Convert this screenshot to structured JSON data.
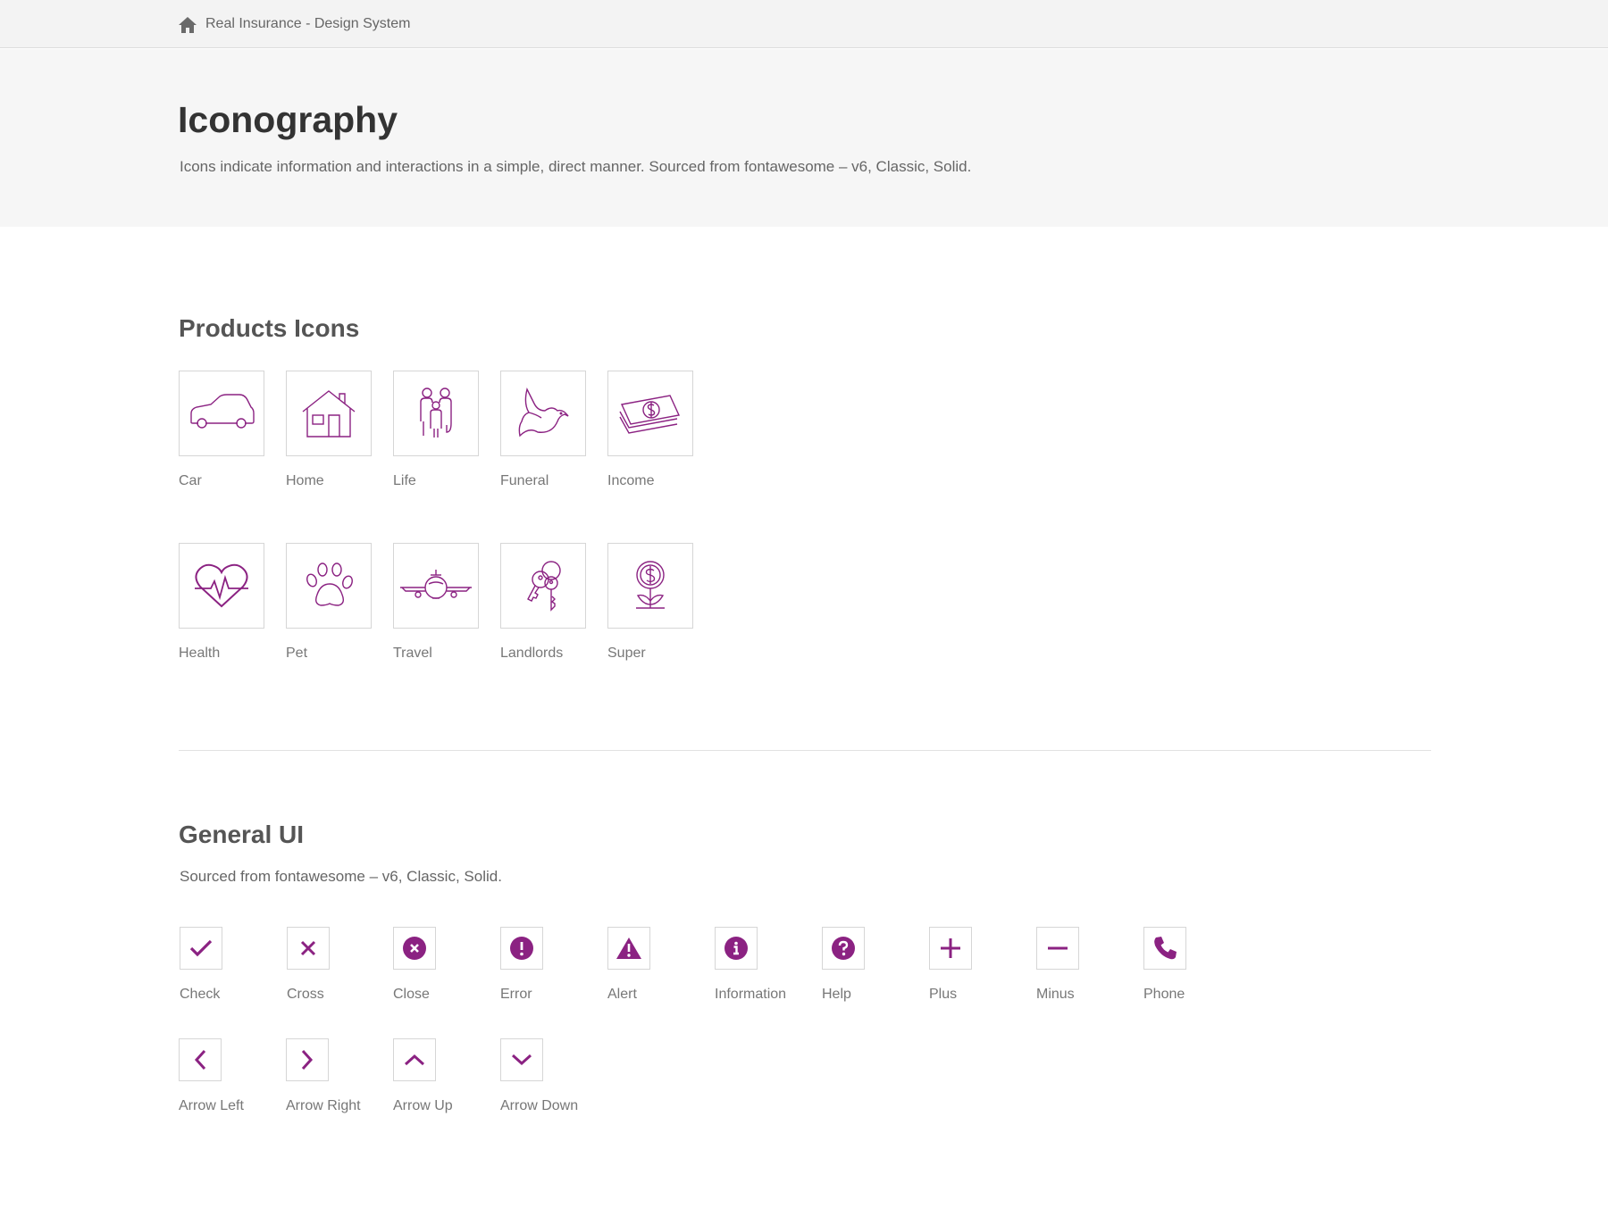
{
  "header": {
    "breadcrumb": "Real Insurance - Design System",
    "home_icon": "home-icon"
  },
  "hero": {
    "title": "Iconography",
    "description": "Icons indicate information and interactions in a simple, direct manner. Sourced from fontawesome – v6, Classic, Solid."
  },
  "products": {
    "title": "Products Icons",
    "items": [
      {
        "label": "Car",
        "icon": "car-icon"
      },
      {
        "label": "Home",
        "icon": "house-icon"
      },
      {
        "label": "Life",
        "icon": "family-icon"
      },
      {
        "label": "Funeral",
        "icon": "dove-icon"
      },
      {
        "label": "Income",
        "icon": "money-icon"
      },
      {
        "label": "Health",
        "icon": "heart-pulse-icon"
      },
      {
        "label": "Pet",
        "icon": "paw-icon"
      },
      {
        "label": "Travel",
        "icon": "plane-icon"
      },
      {
        "label": "Landlords",
        "icon": "keys-icon"
      },
      {
        "label": "Super",
        "icon": "money-plant-icon"
      }
    ]
  },
  "general": {
    "title": "General UI",
    "subtitle": "Sourced from fontawesome – v6, Classic, Solid.",
    "items": [
      {
        "label": "Check",
        "icon": "check-icon"
      },
      {
        "label": "Cross",
        "icon": "cross-icon"
      },
      {
        "label": "Close",
        "icon": "close-circle-icon"
      },
      {
        "label": "Error",
        "icon": "error-circle-icon"
      },
      {
        "label": "Alert",
        "icon": "alert-triangle-icon"
      },
      {
        "label": "Information",
        "icon": "information-circle-icon"
      },
      {
        "label": "Help",
        "icon": "help-circle-icon"
      },
      {
        "label": "Plus",
        "icon": "plus-icon"
      },
      {
        "label": "Minus",
        "icon": "minus-icon"
      },
      {
        "label": "Phone",
        "icon": "phone-icon"
      },
      {
        "label": "Arrow Left",
        "icon": "arrow-left-icon"
      },
      {
        "label": "Arrow Right",
        "icon": "arrow-right-icon"
      },
      {
        "label": "Arrow Up",
        "icon": "arrow-up-icon"
      },
      {
        "label": "Arrow Down",
        "icon": "arrow-down-icon"
      }
    ]
  },
  "colors": {
    "accent": "#8b2282",
    "border": "#d6d6d6",
    "header_bg": "#f3f3f3",
    "hero_bg": "#f6f6f6"
  }
}
